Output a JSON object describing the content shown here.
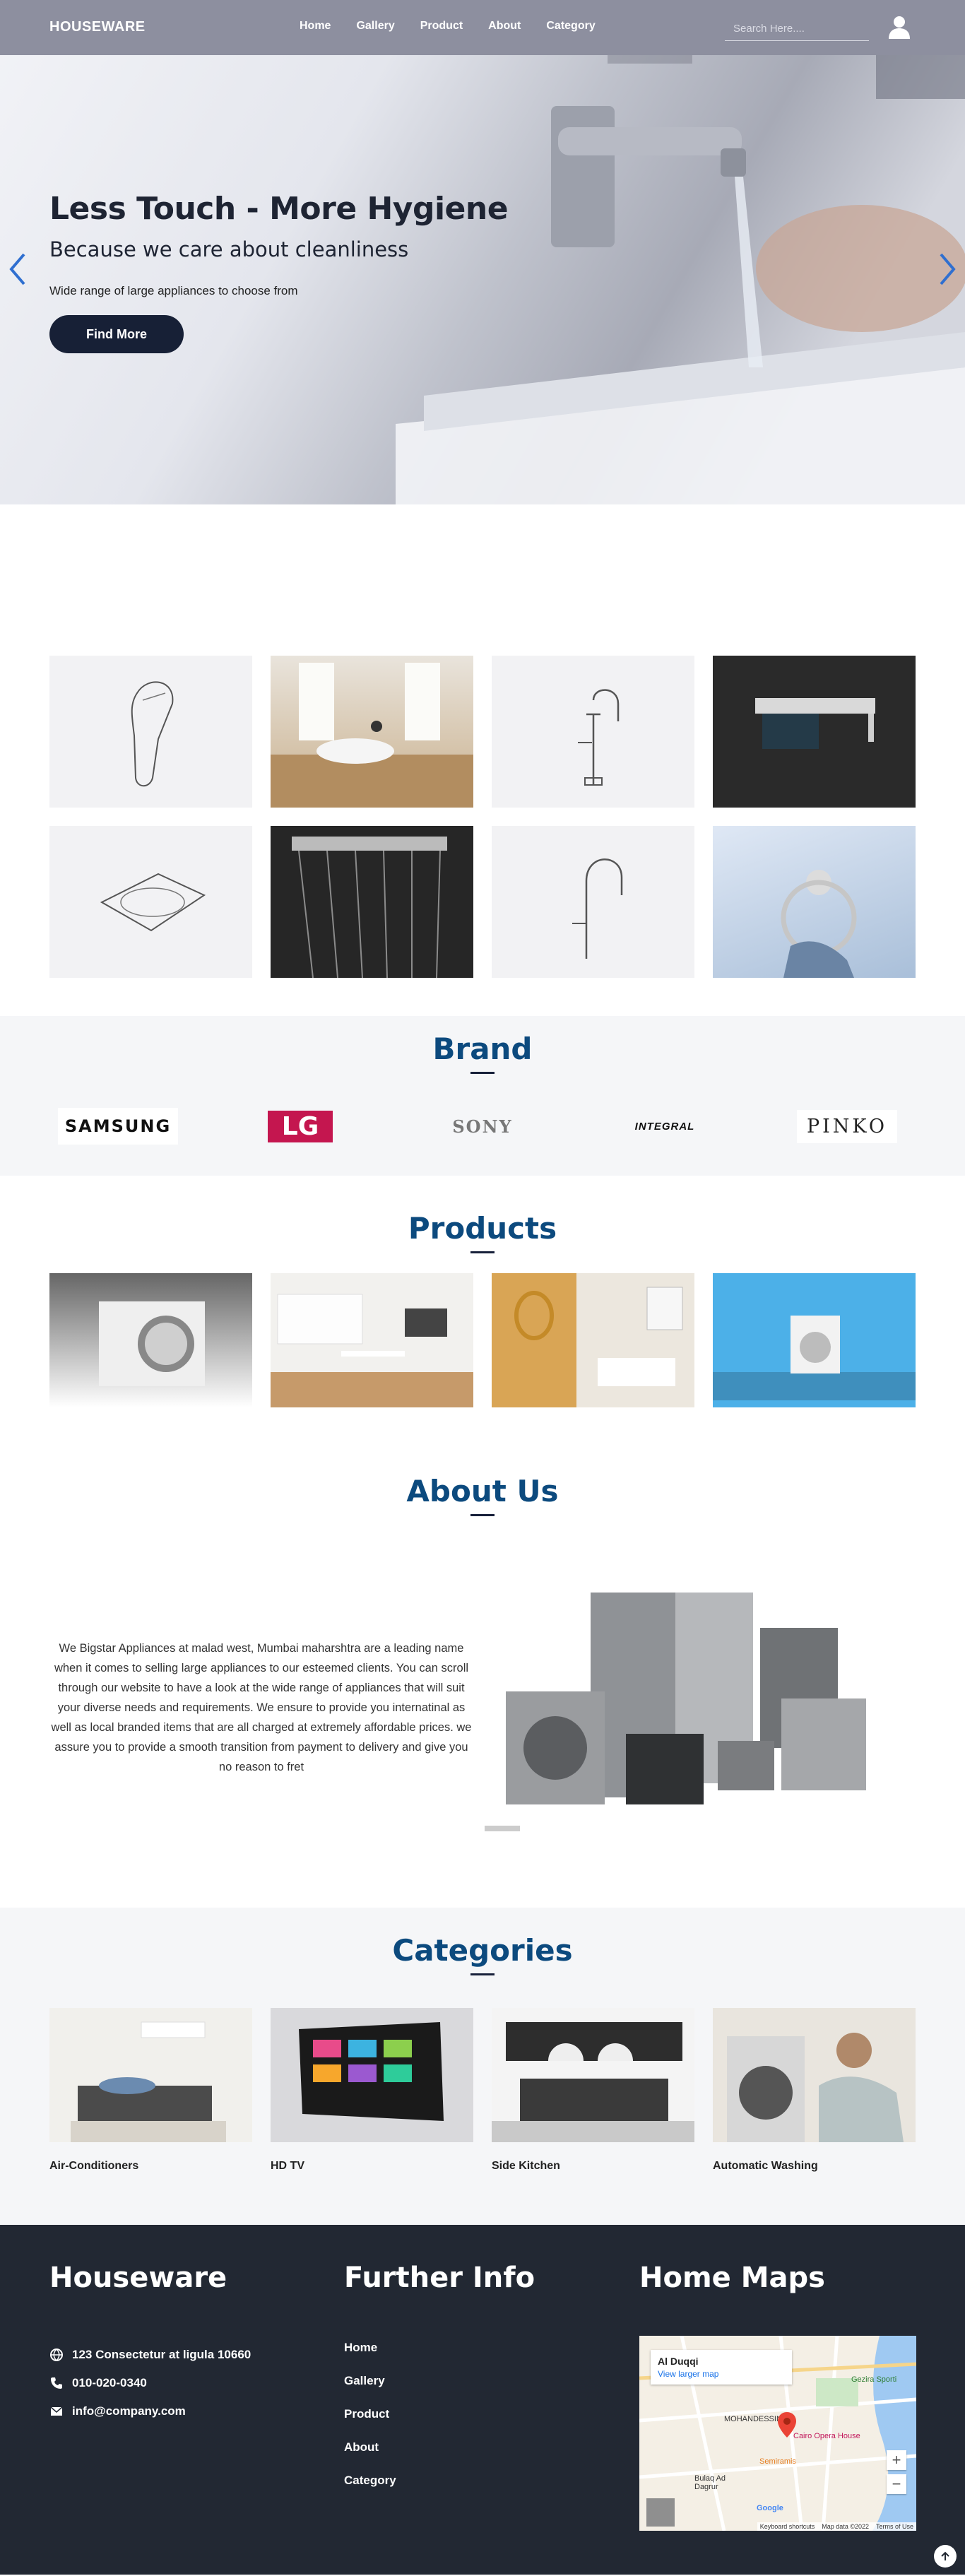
{
  "nav": {
    "brand": "HOUSEWARE",
    "links": [
      "Home",
      "Gallery",
      "Product",
      "About",
      "Category"
    ],
    "search_placeholder": "Search Here...."
  },
  "hero": {
    "title": "Less Touch - More Hygiene",
    "subtitle": "Because we care about cleanliness",
    "text": "Wide range of large appliances to choose from",
    "button": "Find More"
  },
  "brand": {
    "title": "Brand",
    "logos": [
      "SAMSUNG",
      "LG",
      "SONY",
      "INTEGRAL",
      "PINKO"
    ]
  },
  "products": {
    "title": "Products"
  },
  "about": {
    "title": "About Us",
    "text": "We Bigstar Appliances at malad west, Mumbai maharshtra are a leading name when it comes to selling large appliances to our esteemed clients. You can scroll through our website to have a look at the wide range of appliances that will suit your diverse needs and requirements. We ensure to provide you internatinal as well as local branded items that are all charged at extremely affordable prices. we assure you to provide a smooth transition from payment to delivery and give you no reason to fret"
  },
  "categories": {
    "title": "Categories",
    "items": [
      "Air-Conditioners",
      "HD TV",
      "Side Kitchen",
      "Automatic Washing"
    ]
  },
  "footer": {
    "col1_title": "Houseware",
    "address": "123 Consectetur at ligula 10660",
    "phone": "010-020-0340",
    "email": "info@company.com",
    "col2_title": "Further Info",
    "links": [
      "Home",
      "Gallery",
      "Product",
      "About",
      "Category"
    ],
    "col3_title": "Home Maps",
    "map": {
      "place": "Al Duqqi",
      "link": "View larger map",
      "labels": [
        "MOHANDESSIN",
        "Bulaq Ad Dagrur",
        "Cairo Opera House",
        "Semiramis",
        "Gezira Sporti",
        "Google"
      ],
      "footer": [
        "Keyboard shortcuts",
        "Map data ©2022",
        "Terms of Use"
      ]
    }
  }
}
